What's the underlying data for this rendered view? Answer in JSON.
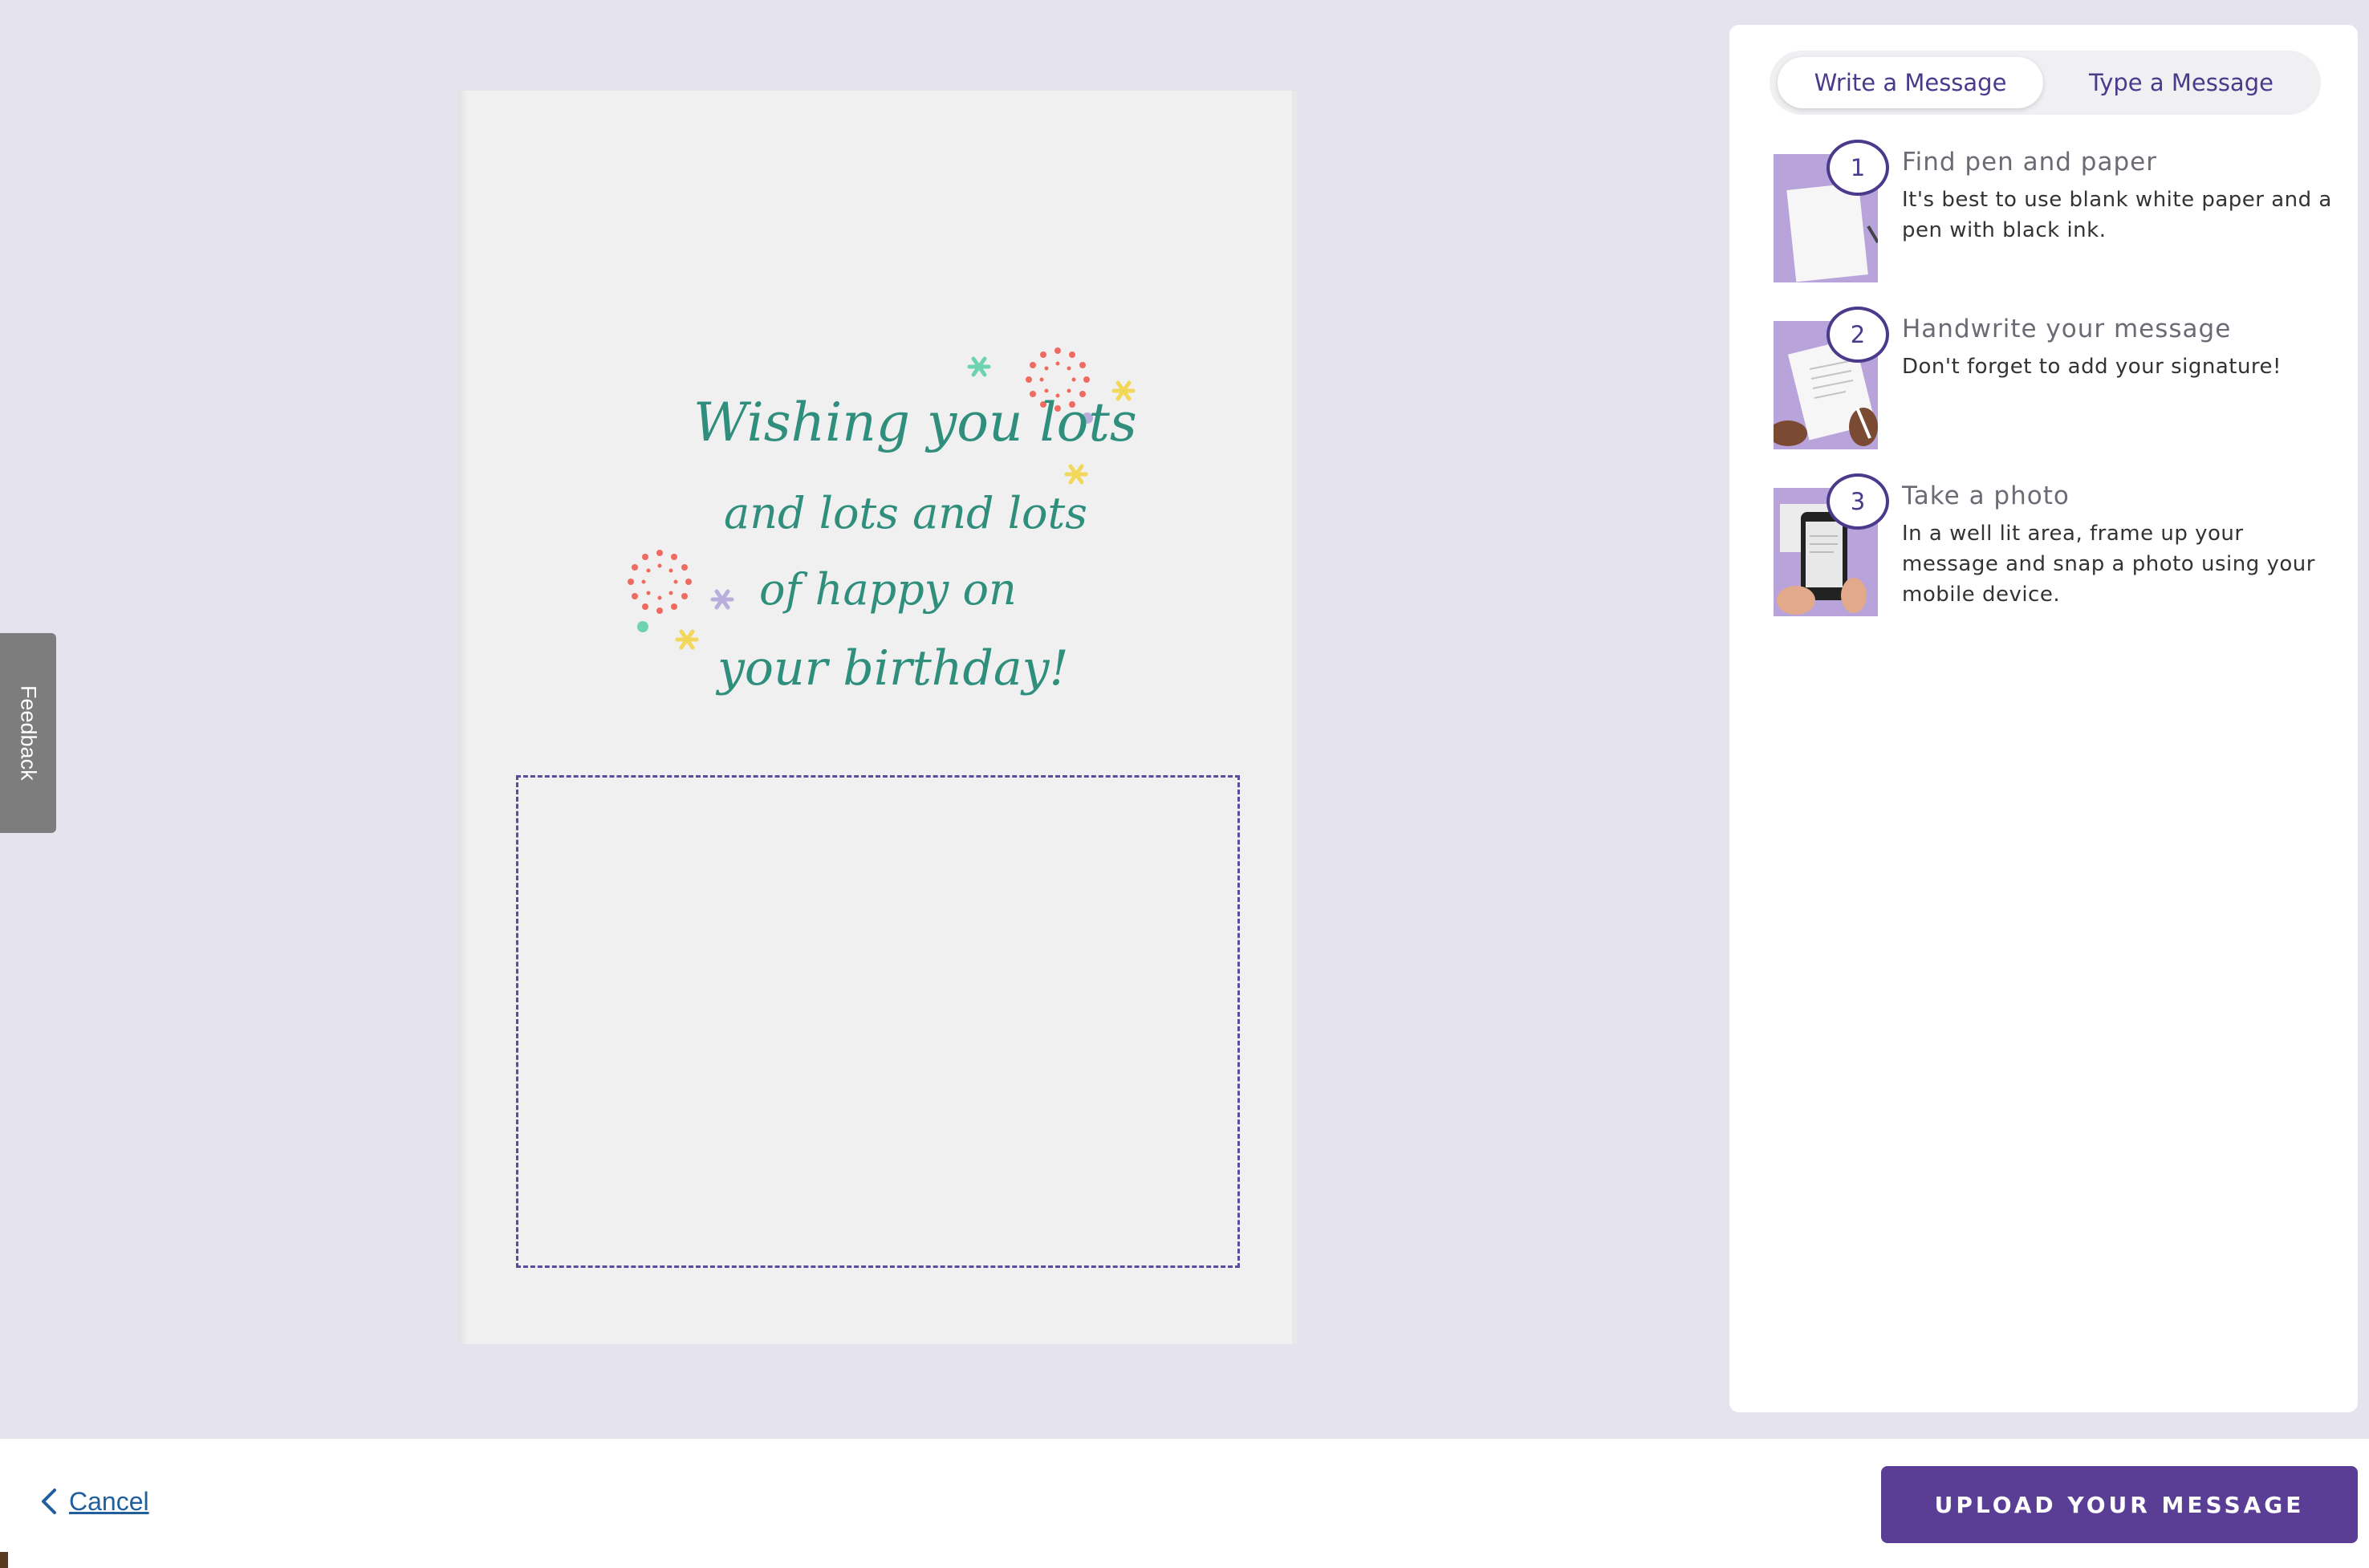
{
  "feedback": {
    "label": "Feedback"
  },
  "card": {
    "lines": [
      "Wishing you lots",
      "and lots and lots",
      "of happy on",
      "your birthday!"
    ],
    "colors": {
      "text": "#2f8f7c",
      "burst": "#ef6b5f",
      "star_yellow": "#f2d75a",
      "star_teal": "#6dd3b3",
      "star_lilac": "#b8aedb"
    }
  },
  "panel": {
    "tabs": [
      {
        "label": "Write a Message",
        "active": true
      },
      {
        "label": "Type a Message",
        "active": false
      }
    ],
    "steps": [
      {
        "number": "1",
        "title": "Find pen and paper",
        "desc": "It's best to use blank white paper and a pen with black ink.",
        "icon": "paper-photo"
      },
      {
        "number": "2",
        "title": "Handwrite your message",
        "desc": "Don't forget to add your signature!",
        "icon": "handwriting-photo"
      },
      {
        "number": "3",
        "title": "Take a photo",
        "desc": "In a well lit area, frame up your message and snap a photo using your mobile device.",
        "icon": "phone-photo"
      }
    ]
  },
  "footer": {
    "cancel_label": "Cancel",
    "upload_label": "UPLOAD YOUR MESSAGE"
  },
  "colors": {
    "accent": "#5a3d94",
    "link": "#1f5f9e",
    "background": "#e5e3ee"
  }
}
